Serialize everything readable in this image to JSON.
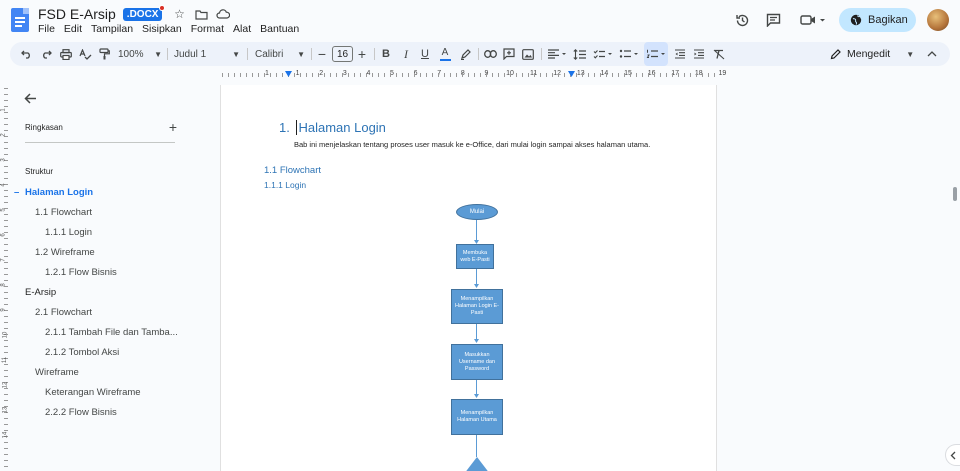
{
  "document": {
    "title": "FSD E-Arsip",
    "extension_badge": ".DOCX"
  },
  "menu": [
    "File",
    "Edit",
    "Tampilan",
    "Sisipkan",
    "Format",
    "Alat",
    "Bantuan"
  ],
  "header_actions": {
    "share_label": "Bagikan"
  },
  "toolbar": {
    "zoom": "100%",
    "style": "Judul 1",
    "font": "Calibri",
    "font_size": "16",
    "bold": "B",
    "italic": "I",
    "underline": "U",
    "mode": "Mengedit"
  },
  "ruler": {
    "numbers": [
      "1",
      "1",
      "2",
      "3",
      "4",
      "5",
      "6",
      "7",
      "8",
      "9",
      "10",
      "11",
      "12",
      "13",
      "14",
      "15",
      "16",
      "17",
      "18",
      "19"
    ]
  },
  "vertical_ruler": {
    "numbers": [
      "1",
      "2",
      "3",
      "4",
      "5",
      "6",
      "7",
      "8",
      "9",
      "10",
      "11",
      "12",
      "13",
      "14"
    ]
  },
  "sidebar": {
    "summary_label": "Ringkasan",
    "structure_label": "Struktur",
    "outline": [
      {
        "label": "Halaman Login",
        "level": 1,
        "active": true
      },
      {
        "label": "1.1 Flowchart",
        "level": 2
      },
      {
        "label": "1.1.1 Login",
        "level": 3
      },
      {
        "label": "1.2 Wireframe",
        "level": 2
      },
      {
        "label": "1.2.1 Flow Bisnis",
        "level": 3
      },
      {
        "label": "E-Arsip",
        "level": 1
      },
      {
        "label": "2.1 Flowchart",
        "level": 2
      },
      {
        "label": "2.1.1 Tambah File dan Tamba...",
        "level": 3
      },
      {
        "label": "2.1.2 Tombol Aksi",
        "level": 3
      },
      {
        "label": "Wireframe",
        "level": 2
      },
      {
        "label": "Keterangan Wireframe",
        "level": 3
      },
      {
        "label": "2.2.2 Flow Bisnis",
        "level": 3
      }
    ]
  },
  "page": {
    "heading_number": "1.",
    "heading": "Halaman Login",
    "intro": "Bab ini menjelaskan tentang proses user masuk ke e-Office, dari mulai login sampai akses halaman utama.",
    "subheading": "1.1 Flowchart",
    "subsubheading": "1.1.1  Login",
    "flowchart": [
      {
        "type": "ellipse",
        "text": "Mulai"
      },
      {
        "type": "process",
        "text": "Membuka web E-Pasti"
      },
      {
        "type": "process",
        "text": "Menampilkan Halaman Login E-Pasti"
      },
      {
        "type": "process",
        "text": "Masukkan Username dan Password"
      },
      {
        "type": "process",
        "text": "Menampilkan Halaman Utama"
      }
    ]
  },
  "colors": {
    "accent": "#1a73e8",
    "heading": "#2e74b5",
    "flow_fill": "#5b9bd5",
    "share_bg": "#c2e7ff"
  }
}
